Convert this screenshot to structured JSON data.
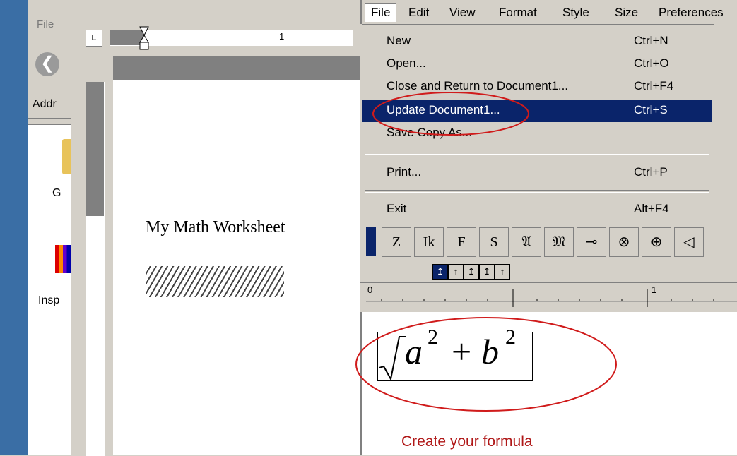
{
  "explorer": {
    "menu_file": "File",
    "address_label": "Addr",
    "icon_label_1": "G",
    "icon_label_2": "Insp"
  },
  "word": {
    "ruler_l": "L",
    "ruler_number": "1",
    "doc_title": "My Math Worksheet"
  },
  "equation_editor": {
    "menubar": [
      "File",
      "Edit",
      "View",
      "Format",
      "Style",
      "Size",
      "Preferences"
    ],
    "file_menu": [
      {
        "label": "New",
        "shortcut": "Ctrl+N"
      },
      {
        "label": "Open...",
        "shortcut": "Ctrl+O"
      },
      {
        "label": "Close and Return to Document1...",
        "shortcut": "Ctrl+F4"
      },
      {
        "label": "Update Document1...",
        "shortcut": "Ctrl+S"
      },
      {
        "label": "Save Copy As...",
        "shortcut": ""
      },
      {
        "label": "Print...",
        "shortcut": "Ctrl+P"
      },
      {
        "label": "Exit",
        "shortcut": "Alt+F4"
      }
    ],
    "highlighted_item": "Update Document1...",
    "symbol_buttons": [
      "Z",
      "Ik",
      "F",
      "S",
      "𝔄",
      "𝔐",
      "⊸",
      "⊗",
      "⊕",
      "◁"
    ],
    "tabs": [
      "↥",
      "↑",
      "↥",
      "↥",
      "↑"
    ],
    "ruler_labels": [
      "0",
      "1"
    ],
    "formula": {
      "base1": "a",
      "exp1": "2",
      "plus": "+",
      "base2": "b",
      "exp2": "2"
    },
    "caption": "Create your formula"
  },
  "colors": {
    "highlight": "#0a246a",
    "annotation": "#d01b1b",
    "caption": "#b01818"
  }
}
